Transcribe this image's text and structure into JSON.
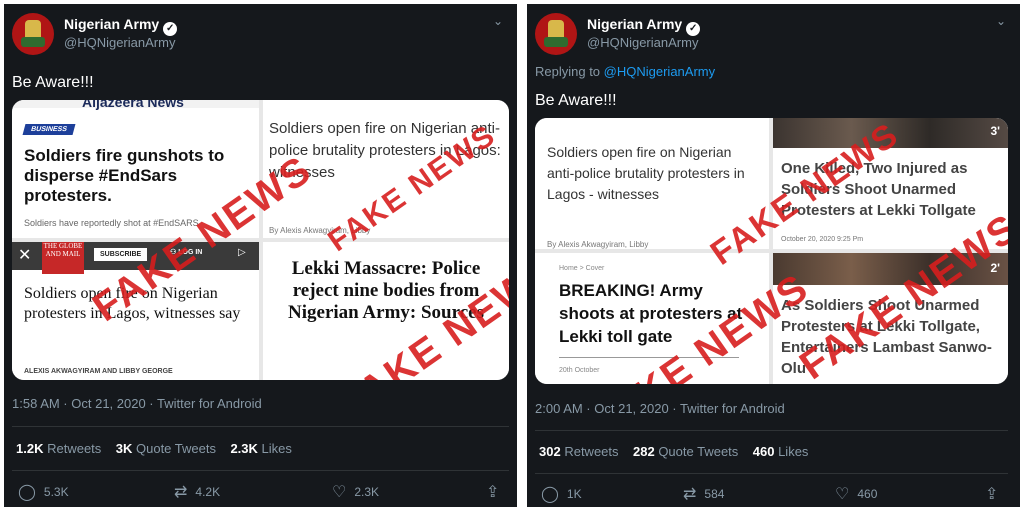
{
  "left_tweet": {
    "name": "Nigerian Army",
    "handle": "@HQNigerianArmy",
    "text": "Be Aware!!!",
    "timestamp": "1:58 AM · Oct 21, 2020 · Twitter for Android",
    "stats": {
      "retweets_count": "1.2K",
      "retweets_label": "Retweets",
      "quotes_count": "3K",
      "quotes_label": "Quote Tweets",
      "likes_count": "2.3K",
      "likes_label": "Likes"
    },
    "actions": {
      "reply": "5.3K",
      "retweet": "4.2K",
      "like": "2.3K"
    },
    "images": {
      "a": {
        "masthead": "Aljazeera News",
        "badge": "BUSINESS",
        "headline": "Soldiers fire gunshots to disperse #EndSars protesters.",
        "sub": "Soldiers have reportedly shot at #EndSARS"
      },
      "b": {
        "headline": "Soldiers open fire on Nigerian anti-police brutality protesters in Lagos: witnesses",
        "byline": "By Alexis Akwagyiram, Libby"
      },
      "c": {
        "logo": "THE GLOBE AND MAIL",
        "subscribe": "SUBSCRIBE",
        "login": "LOG IN",
        "headline": "Soldiers open fire on Nigerian protesters in Lagos, witnesses say",
        "byline": "ALEXIS AKWAGYIRAM AND LIBBY GEORGE"
      },
      "d": {
        "headline": "Lekki Massacre: Police reject nine bodies from Nigerian Army: Sources"
      }
    },
    "stamp": "FAKE NEWS"
  },
  "right_tweet": {
    "name": "Nigerian Army",
    "handle": "@HQNigerianArmy",
    "replying_prefix": "Replying to",
    "replying_handle": "@HQNigerianArmy",
    "text": "Be Aware!!!",
    "timestamp": "2:00 AM · Oct 21, 2020 · Twitter for Android",
    "stats": {
      "retweets_count": "302",
      "retweets_label": "Retweets",
      "quotes_count": "282",
      "quotes_label": "Quote Tweets",
      "likes_count": "460",
      "likes_label": "Likes"
    },
    "actions": {
      "reply": "1K",
      "retweet": "584",
      "like": "460"
    },
    "images": {
      "a": {
        "headline": "Soldiers open fire on Nigerian anti-police brutality protesters in Lagos - witnesses",
        "byline": "By Alexis Akwagyiram, Libby"
      },
      "b": {
        "duration": "3'",
        "headline": "One Killed, Two Injured as Soldiers Shoot Unarmed Protesters at Lekki Tollgate",
        "date": "October 20, 2020 9:25 Pm"
      },
      "c": {
        "crumb": "Home > Cover",
        "headline": "BREAKING! Army shoots at protesters at Lekki toll gate",
        "date": "20th October"
      },
      "d": {
        "duration": "2'",
        "headline": "As Soldiers Shoot Unarmed Protesters at Lekki Tollgate, Entertainers Lambast Sanwo-Olu"
      }
    },
    "stamp": "FAKE NEWS"
  },
  "colors": {
    "background": "#15181c",
    "text": "#ffffff",
    "muted": "#8899a6",
    "accent": "#1d9bf0",
    "stamp": "#d71e1e"
  },
  "icons": [
    "verified-badge-icon",
    "chevron-down-icon",
    "reply-icon",
    "retweet-icon",
    "like-icon",
    "share-icon",
    "close-icon",
    "user-icon",
    "play-icon"
  ]
}
